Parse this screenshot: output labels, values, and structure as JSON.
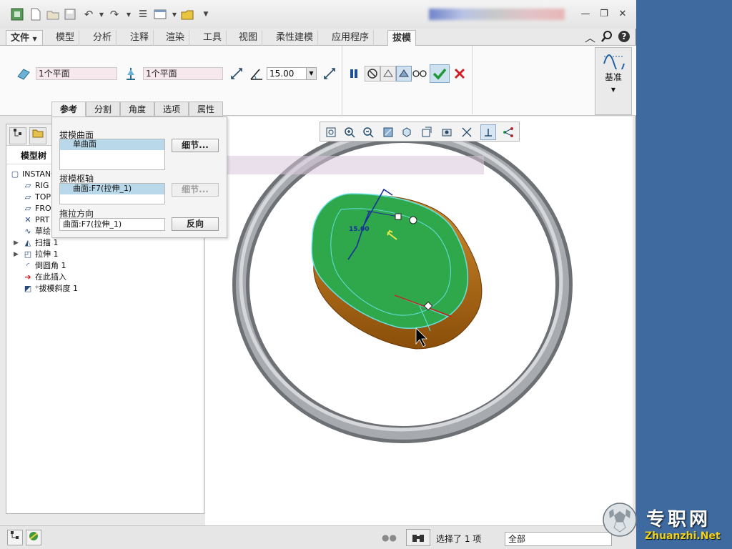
{
  "ribbon_tabs": {
    "file": "文件",
    "model": "模型",
    "analysis": "分析",
    "annotate": "注释",
    "render": "渲染",
    "tools": "工具",
    "view": "视图",
    "flexible": "柔性建模",
    "apps": "应用程序",
    "draft": "拔模"
  },
  "ribbon": {
    "draft_hinge_field": "1个平面",
    "draft_hinge_field2": "1个平面",
    "angle_value": "15.00",
    "datum_label": "基准"
  },
  "sub_tabs": {
    "references": "参考",
    "splits": "分割",
    "angles": "角度",
    "options": "选项",
    "properties": "属性"
  },
  "references_panel": {
    "draft_surfaces_label": "拔模曲面",
    "draft_surfaces_item": "单曲面",
    "draft_hinges_label": "拔模枢轴",
    "draft_hinges_item": "曲面:F7(拉伸_1)",
    "pull_direction_label": "拖拉方向",
    "pull_direction_value": "曲面:F7(拉伸_1)",
    "details_button": "细节...",
    "details_button2": "细节...",
    "flip_button": "反向"
  },
  "model_tree": {
    "header": "模型树",
    "items": [
      {
        "label": "INSTANC",
        "icon": "part-icon"
      },
      {
        "label": "RIG",
        "icon": "datum-plane-icon"
      },
      {
        "label": "TOP",
        "icon": "datum-plane-icon"
      },
      {
        "label": "FRO",
        "icon": "datum-plane-icon"
      },
      {
        "label": "PRT",
        "icon": "csys-icon"
      },
      {
        "label": "草绘",
        "icon": "sketch-icon"
      },
      {
        "label": "扫描 1",
        "icon": "sweep-icon"
      },
      {
        "label": "拉伸 1",
        "icon": "extrude-icon"
      },
      {
        "label": "倒圆角 1",
        "icon": "round-icon"
      },
      {
        "label": "在此插入",
        "icon": "insert-here-icon"
      },
      {
        "label": "拔模斜度 1",
        "icon": "draft-icon"
      }
    ]
  },
  "viewport": {
    "dimension_label": "15.00"
  },
  "status_bar": {
    "selection_text": "选择了 1 项",
    "filter_value": "全部"
  },
  "watermark": {
    "text_cn": "专职网",
    "text_en": "Zhuanzhi.Net"
  },
  "colors": {
    "model_green": "#2ea84a",
    "model_brown": "#b96a12",
    "ring_gray": "#8c8f93",
    "accent_blue": "#1f5f9f"
  }
}
